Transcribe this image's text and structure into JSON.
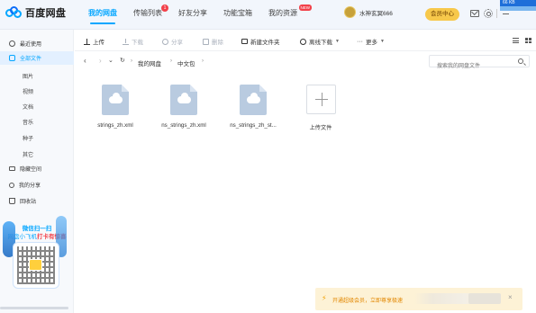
{
  "app": {
    "name": "百度网盘",
    "corner_label": "66 KB"
  },
  "nav": {
    "tabs": [
      {
        "label": "我的网盘",
        "active": true
      },
      {
        "label": "传输列表",
        "badge": "1"
      },
      {
        "label": "好友分享"
      },
      {
        "label": "功能宝箱"
      },
      {
        "label": "我的资源",
        "badge": "NEW"
      }
    ]
  },
  "user": {
    "name": "水神玄冥666",
    "vip_label": "会员中心"
  },
  "sidebar": {
    "items": [
      {
        "label": "最近使用",
        "icon": "clock-icon"
      },
      {
        "label": "全部文件",
        "icon": "folder-icon",
        "active": true
      }
    ],
    "subitems": [
      "图片",
      "视频",
      "文档",
      "音乐",
      "种子",
      "其它"
    ],
    "bottom_items": [
      {
        "label": "隐藏空间",
        "icon": "lock-icon"
      },
      {
        "label": "我的分享",
        "icon": "share-icon"
      },
      {
        "label": "回收站",
        "icon": "trash-icon"
      }
    ],
    "promo": {
      "title": "微信扫一扫",
      "line_prefix": "网盘小飞机",
      "line_highlight": "打卡有惊喜"
    }
  },
  "toolbar": {
    "upload": "上传",
    "download": "下载",
    "share": "分享",
    "delete": "删除",
    "new_folder": "新建文件夹",
    "offline_download": "离线下载",
    "more": "更多"
  },
  "path": {
    "crumbs": [
      "我的网盘",
      "中文包"
    ],
    "search_placeholder": "搜索我的网盘文件"
  },
  "files": [
    {
      "name": "strings_zh.xml"
    },
    {
      "name": "ns_strings_zh.xml"
    },
    {
      "name": "ns_strings_zh_st..."
    }
  ],
  "upload_tile": {
    "label": "上传文件"
  },
  "notice": {
    "text": "开通超级会员，立即尊享极速"
  },
  "colors": {
    "accent": "#06a7ff",
    "badge": "#f2414a",
    "vip": "#f7c84b",
    "notice_bg": "#fdf2d6"
  }
}
